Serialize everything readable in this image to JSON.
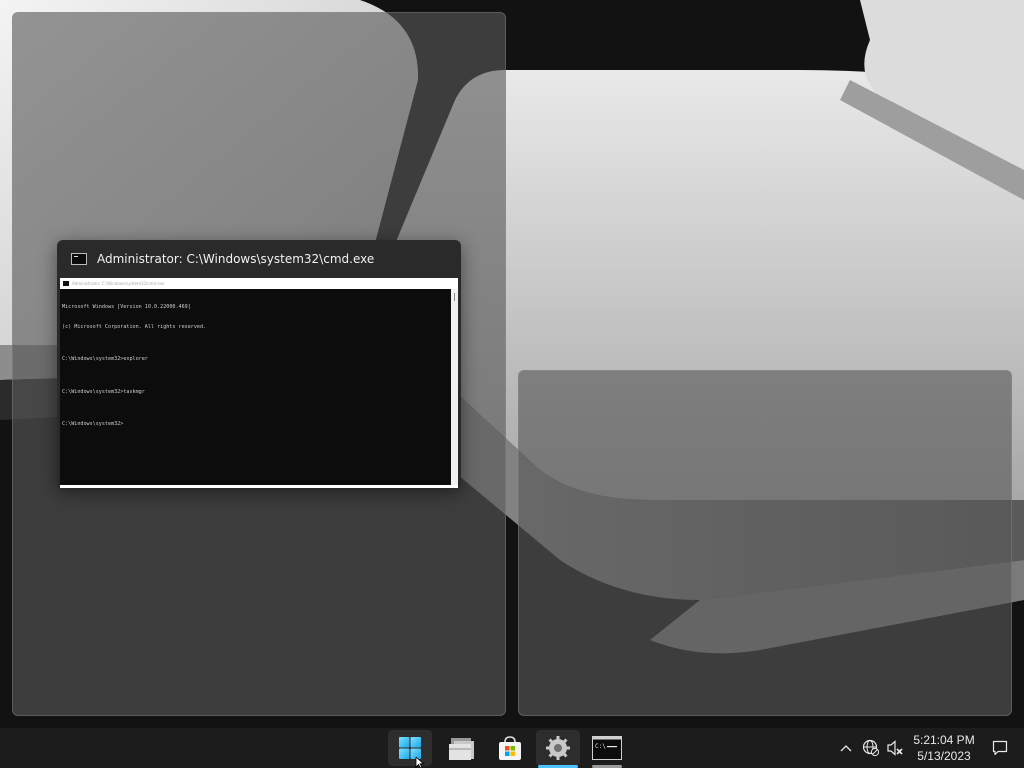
{
  "cmd_window": {
    "title": "Administrator: C:\\Windows\\system32\\cmd.exe",
    "inner_title": "Administrator: C:\\Windows\\system32\\cmd.exe",
    "console_lines": [
      "Microsoft Windows [Version 10.0.22000.469]",
      "(c) Microsoft Corporation. All rights reserved.",
      "",
      "C:\\Windows\\system32>explorer",
      "",
      "C:\\Windows\\system32>taskmgr",
      "",
      "C:\\Windows\\system32>"
    ]
  },
  "taskbar": {
    "apps": [
      {
        "id": "start",
        "icon": "windows-logo-icon"
      },
      {
        "id": "explorer",
        "icon": "file-explorer-icon"
      },
      {
        "id": "store",
        "icon": "microsoft-store-icon"
      },
      {
        "id": "settings",
        "icon": "settings-gear-icon",
        "state": "active"
      },
      {
        "id": "terminal",
        "icon": "command-prompt-icon",
        "state": "running"
      }
    ],
    "tray": {
      "chevron": "^",
      "time": "5:21:04 PM",
      "date": "5/13/2023"
    },
    "colors": {
      "accent": "#4cc2ff",
      "taskbar_bg": "#1c1c1c"
    }
  }
}
